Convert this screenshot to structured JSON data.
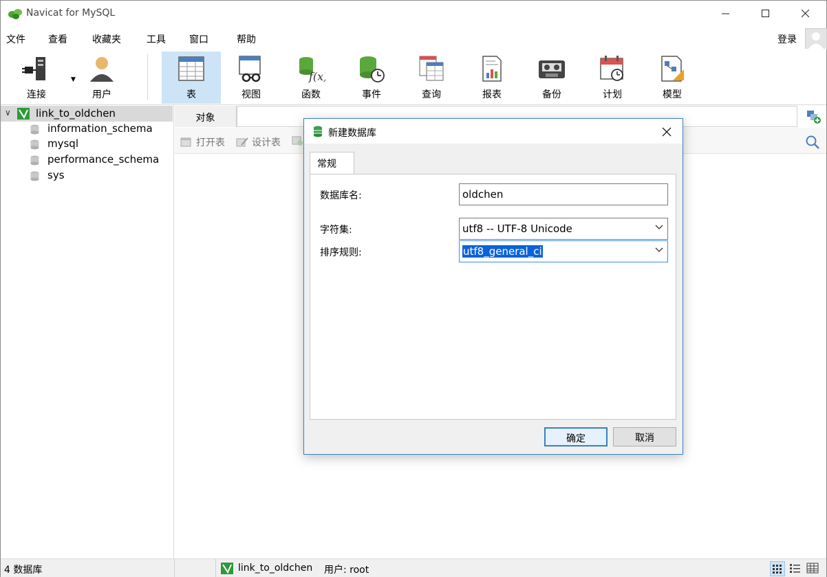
{
  "window": {
    "title": "Navicat for MySQL"
  },
  "menu": {
    "items": [
      "文件",
      "查看",
      "收藏夹",
      "工具",
      "窗口",
      "帮助"
    ],
    "login_label": "登录"
  },
  "toolbar": {
    "buttons": [
      {
        "label": "连接",
        "icon": "plug-icon"
      },
      {
        "label": "用户",
        "icon": "user-icon"
      },
      {
        "label": "表",
        "icon": "table-icon"
      },
      {
        "label": "视图",
        "icon": "view-icon"
      },
      {
        "label": "函数",
        "icon": "function-icon"
      },
      {
        "label": "事件",
        "icon": "event-icon"
      },
      {
        "label": "查询",
        "icon": "query-icon"
      },
      {
        "label": "报表",
        "icon": "report-icon"
      },
      {
        "label": "备份",
        "icon": "backup-icon"
      },
      {
        "label": "计划",
        "icon": "schedule-icon"
      },
      {
        "label": "模型",
        "icon": "model-icon"
      }
    ],
    "active": "表"
  },
  "sidebar": {
    "connection": "link_to_oldchen",
    "databases": [
      "information_schema",
      "mysql",
      "performance_schema",
      "sys"
    ]
  },
  "objects": {
    "tab_label": "对象",
    "tools": [
      "打开表",
      "设计表"
    ]
  },
  "status": {
    "db_count": "4 数据库",
    "connection": "link_to_oldchen",
    "user": "用户: root"
  },
  "dialog": {
    "title": "新建数据库",
    "tab": "常规",
    "fields": {
      "name_label": "数据库名:",
      "name_value": "oldchen",
      "charset_label": "字符集:",
      "charset_value": "utf8 -- UTF-8 Unicode",
      "collation_label": "排序规则:",
      "collation_value": "utf8_general_ci"
    },
    "ok_label": "确定",
    "cancel_label": "取消"
  },
  "colors": {
    "accent": "#3a7fc1",
    "active_bg": "#cde4f7",
    "navicat_green": "#2d9a3a",
    "selection": "#0a64d8"
  }
}
